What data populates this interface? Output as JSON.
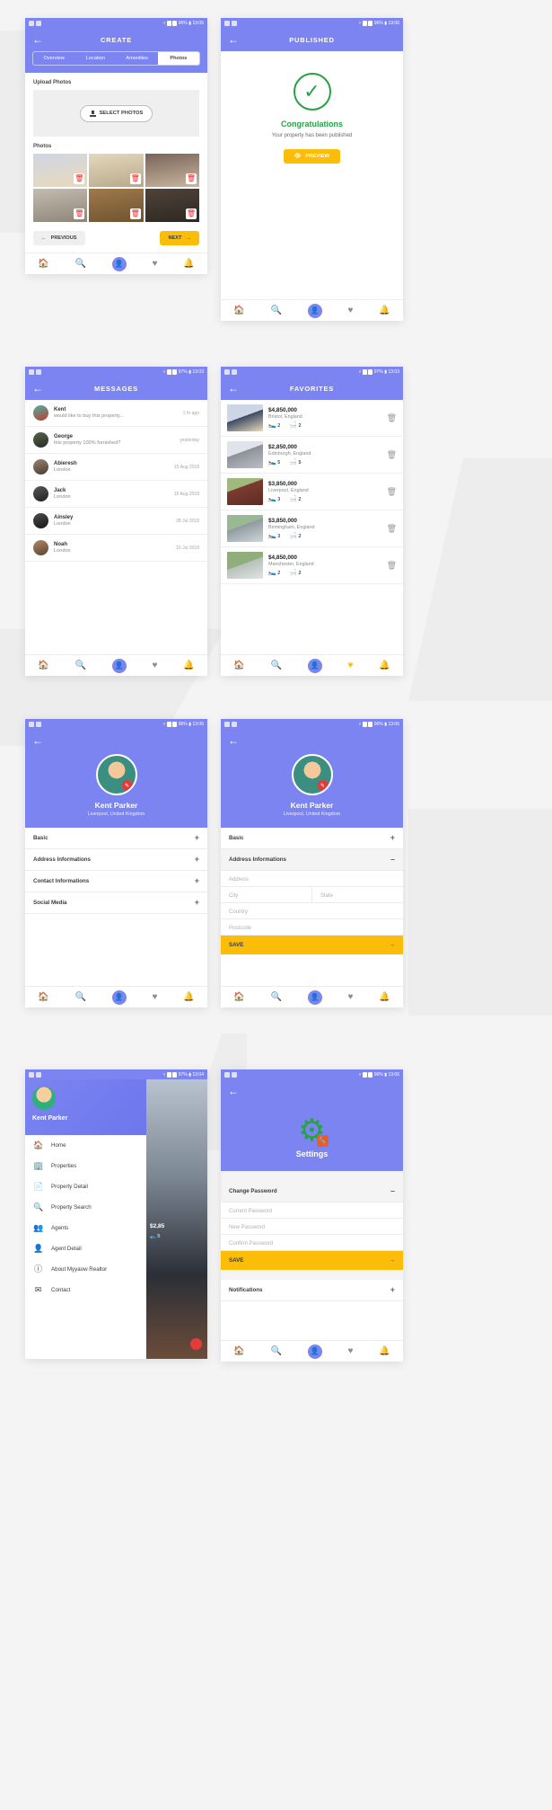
{
  "theme": {
    "primary": "#7b84f0",
    "accent": "#fbbd08",
    "success": "#25a244",
    "danger": "#ef2b2b"
  },
  "status_bar": {
    "left_icons": [
      "image-icon",
      "screenshot-icon"
    ],
    "wifi": "wifi-icon",
    "battery_num": "1",
    "signal": "signal-icon",
    "variants": [
      {
        "battery_pct": "96%",
        "time": "13:06"
      },
      {
        "battery_pct": "96%",
        "time": "13:06"
      },
      {
        "battery_pct": "97%",
        "time": "13:03"
      },
      {
        "battery_pct": "97%",
        "time": "13:03"
      },
      {
        "battery_pct": "96%",
        "time": "13:06"
      },
      {
        "battery_pct": "96%",
        "time": "13:06"
      },
      {
        "battery_pct": "97%",
        "time": "13:04"
      },
      {
        "battery_pct": "96%",
        "time": "13:06"
      }
    ]
  },
  "bottom_nav": {
    "items": [
      {
        "icon": "home-icon",
        "glyph": "⌂"
      },
      {
        "icon": "search-icon",
        "glyph": "⚲"
      },
      {
        "icon": "profile-icon",
        "glyph": "●"
      },
      {
        "icon": "heart-icon",
        "glyph": "♥"
      },
      {
        "icon": "bell-icon",
        "glyph": "ὑ4"
      }
    ]
  },
  "screens": {
    "create": {
      "title": "CREATE",
      "back": "back-arrow",
      "tabs": [
        {
          "label": "Overview",
          "active": false
        },
        {
          "label": "Location",
          "active": false
        },
        {
          "label": "Amenities",
          "active": false
        },
        {
          "label": "Photos",
          "active": true
        }
      ],
      "upload_label": "Upload Photos",
      "select_photos_button": "SELECT PHOTOS",
      "photos_label": "Photos",
      "photos": [
        {
          "name": "house-exterior",
          "c1": "#cfd6e3",
          "c2": "#e9d9bb"
        },
        {
          "name": "kitchen-interior",
          "c1": "#d8c9b0",
          "c2": "#b8a98c"
        },
        {
          "name": "dark-loft",
          "c1": "#6b5b52",
          "c2": "#c9b79f"
        },
        {
          "name": "living-room",
          "c1": "#b9b2a6",
          "c2": "#8d8578"
        },
        {
          "name": "library-room",
          "c1": "#a0794b",
          "c2": "#6e5330"
        },
        {
          "name": "bedroom",
          "c1": "#4e4339",
          "c2": "#2e2822"
        }
      ],
      "previous_button": "PREVIOUS",
      "next_button": "NEXT"
    },
    "published": {
      "title": "PUBLISHED",
      "check_icon": "check-circle-icon",
      "heading": "Congratulations",
      "subtext": "Your property has been published",
      "preview_button": "PREVIEW",
      "preview_icon": "eye-icon"
    },
    "messages": {
      "title": "MESSAGES",
      "items": [
        {
          "name": "Kent",
          "preview": "would like to buy this property...",
          "time": "1 hr ago",
          "avatar": "#3aa89a"
        },
        {
          "name": "George",
          "preview": "this property 100% furnished?",
          "time": "yesterday",
          "avatar": "#4a5e3d"
        },
        {
          "name": "Abieresh",
          "preview": "London",
          "time": "15 Aug 2018",
          "avatar": "#7a6a5a"
        },
        {
          "name": "Jack",
          "preview": "London",
          "time": "15 Aug 2018",
          "avatar": "#3c3c3c"
        },
        {
          "name": "Ainsley",
          "preview": "London",
          "time": "28 Jul 2018",
          "avatar": "#2d2d2d"
        },
        {
          "name": "Noah",
          "preview": "London",
          "time": "15 Jul 2018",
          "avatar": "#8b6f55"
        }
      ]
    },
    "favorites": {
      "title": "FAVORITES",
      "items": [
        {
          "price": "$4,850,000",
          "location": "Bristol, England",
          "beds": "2",
          "baths": "2",
          "img1": "#cdd6e6",
          "img2": "#e9d9bb"
        },
        {
          "price": "$2,850,000",
          "location": "Edinburgh, England",
          "beds": "5",
          "baths": "5",
          "img1": "#dfe3ea",
          "img2": "#b9bfc8"
        },
        {
          "price": "$3,850,000",
          "location": "Liverpool, England",
          "beds": "3",
          "baths": "2",
          "img1": "#9fba7c",
          "img2": "#7d3b30"
        },
        {
          "price": "$3,850,000",
          "location": "Birmingham, England",
          "beds": "3",
          "baths": "2",
          "img1": "#9bb894",
          "img2": "#cfd6d9"
        },
        {
          "price": "$4,850,000",
          "location": "Manchester, England",
          "beds": "2",
          "baths": "2",
          "img1": "#8fae7a",
          "img2": "#dfe6e2"
        }
      ],
      "bed_icon": "bed-icon",
      "bath_icon": "bath-icon",
      "delete_icon": "trash-icon"
    },
    "profile_collapsed": {
      "name": "Kent Parker",
      "location": "Liverpool, United Kingdom",
      "edit_icon": "edit-badge-icon",
      "sections": [
        {
          "label": "Basic",
          "sign": "+",
          "open": false
        },
        {
          "label": "Address Informations",
          "sign": "+",
          "open": false
        },
        {
          "label": "Contact Informations",
          "sign": "+",
          "open": false
        },
        {
          "label": "Social Media",
          "sign": "+",
          "open": false
        }
      ]
    },
    "profile_expanded": {
      "name": "Kent Parker",
      "location": "Liverpool, United Kingdom",
      "sections": [
        {
          "label": "Basic",
          "sign": "+",
          "open": false
        },
        {
          "label": "Address Informations",
          "sign": "–",
          "open": true
        }
      ],
      "fields": [
        {
          "placeholder": "Address",
          "value": ""
        },
        {
          "placeholder": "City",
          "value": ""
        },
        {
          "placeholder": "State",
          "value": ""
        },
        {
          "placeholder": "Country",
          "value": ""
        },
        {
          "placeholder": "Postcode",
          "value": ""
        }
      ],
      "save_button": "SAVE",
      "save_arrow": "arrow-right-icon"
    },
    "drawer": {
      "user_name": "Kent Parker",
      "menu": [
        {
          "label": "Home",
          "icon": "home-icon",
          "glyph": "⌂"
        },
        {
          "label": "Properties",
          "icon": "building-icon",
          "glyph": "▤"
        },
        {
          "label": "Property Detail",
          "icon": "document-icon",
          "glyph": "▯"
        },
        {
          "label": "Property Search",
          "icon": "search-icon",
          "glyph": "⚲"
        },
        {
          "label": "Agents",
          "icon": "agents-icon",
          "glyph": "♟"
        },
        {
          "label": "Agent Detail",
          "icon": "person-circle-icon",
          "glyph": "◉"
        },
        {
          "label": "About Myyaow Realtor",
          "icon": "info-icon",
          "glyph": "ⓘ"
        },
        {
          "label": "Contact",
          "icon": "mail-icon",
          "glyph": "✉"
        }
      ],
      "bg_price": "$2,85"
    },
    "settings": {
      "gear_icon": "gear-icon",
      "title": "Settings",
      "sections": [
        {
          "label": "Change Password",
          "sign": "–",
          "open": true
        },
        {
          "label": "Notifications",
          "sign": "+",
          "open": false
        }
      ],
      "fields": [
        {
          "placeholder": "Current Password"
        },
        {
          "placeholder": "New Password"
        },
        {
          "placeholder": "Confirm Password"
        }
      ],
      "save_button": "SAVE",
      "save_arrow": "arrow-right-icon"
    }
  }
}
